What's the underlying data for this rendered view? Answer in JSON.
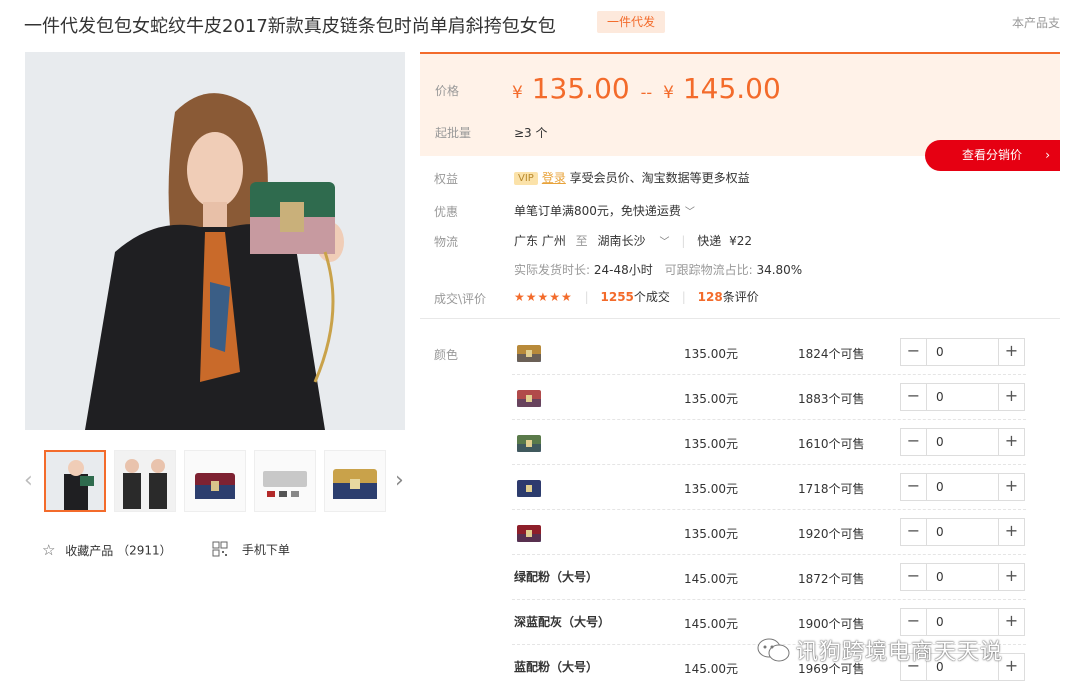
{
  "title": "一件代发包包女蛇纹牛皮2017新款真皮链条包时尚单肩斜挎包女包",
  "badge": "一件代发",
  "right_note": "本产品支",
  "price": {
    "label": "价格",
    "currency": "¥",
    "low": "135.00",
    "high": "145.00",
    "range_dash": "--",
    "moq_label": "起批量",
    "moq_value": "≥3 个"
  },
  "distribution_button": "查看分销价",
  "rights": {
    "label": "权益",
    "vip": "VIP",
    "login": "登录",
    "text": "享受会员价、淘宝数据等更多权益"
  },
  "promo": {
    "label": "优惠",
    "text": "单笔订单满800元，免快递运费"
  },
  "logistics": {
    "label": "物流",
    "origin": "广东 广州",
    "to": "至",
    "destination": "湖南长沙",
    "express": "快递",
    "fee": "¥22",
    "ship_time_label": "实际发货时长:",
    "ship_time": "24-48小时",
    "track_label": "可跟踪物流占比:",
    "track_value": "34.80%"
  },
  "reviews": {
    "label": "成交\\评价",
    "rating": 4.5,
    "stars": "★★★★★",
    "deals_count": "1255",
    "deals_suffix": "个成交",
    "review_count": "128",
    "review_suffix": "条评价"
  },
  "sku": {
    "label": "颜色",
    "rows": [
      {
        "name": "",
        "swatch": "#b88a3a",
        "price": "135.00元",
        "stock": "1824个可售",
        "qty": "0"
      },
      {
        "name": "",
        "swatch": "#b14a4a",
        "price": "135.00元",
        "stock": "1883个可售",
        "qty": "0"
      },
      {
        "name": "",
        "swatch": "#5a7a4a",
        "price": "135.00元",
        "stock": "1610个可售",
        "qty": "0"
      },
      {
        "name": "",
        "swatch": "#2e3a6e",
        "price": "135.00元",
        "stock": "1718个可售",
        "qty": "0"
      },
      {
        "name": "",
        "swatch": "#8e1f2a",
        "price": "135.00元",
        "stock": "1920个可售",
        "qty": "0"
      },
      {
        "name": "绿配粉（大号）",
        "swatch": "",
        "price": "145.00元",
        "stock": "1872个可售",
        "qty": "0"
      },
      {
        "name": "深蓝配灰（大号）",
        "swatch": "",
        "price": "145.00元",
        "stock": "1900个可售",
        "qty": "0"
      },
      {
        "name": "蓝配粉（大号）",
        "swatch": "",
        "price": "145.00元",
        "stock": "1969个可售",
        "qty": "0"
      }
    ]
  },
  "favorite": {
    "label": "收藏产品",
    "count": "（2911）"
  },
  "mobile_order": "手机下单",
  "watermark": "讯狗跨境电商天天说",
  "colors": {
    "accent": "#f36b2b",
    "red_button": "#e60012",
    "price_bg": "#fff2e8"
  }
}
